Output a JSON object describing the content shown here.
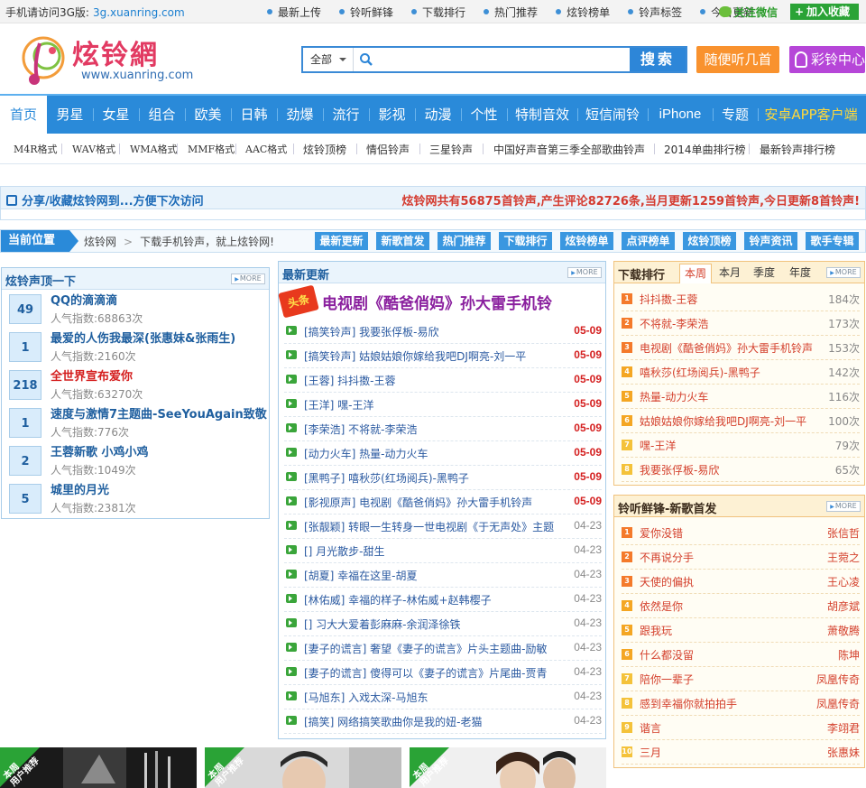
{
  "topbar": {
    "mobile_prefix": "手机请访问3G版:",
    "mobile_url": "3g.xuanring.com",
    "links": [
      "最新上传",
      "铃听鲜锋",
      "下载排行",
      "热门推荐",
      "炫铃榜单",
      "铃声标签",
      "今日更新"
    ],
    "wechat": "关注微信",
    "favorite": "加入收藏"
  },
  "logo": {
    "name": "炫铃網",
    "url": "www.xuanring.com"
  },
  "search": {
    "category": "全部",
    "placeholder": "",
    "button": "搜索"
  },
  "header_buttons": {
    "random": "随便听几首",
    "ring_center": "彩铃中心"
  },
  "main_nav": [
    "首页",
    "男星",
    "女星",
    "组合",
    "欧美",
    "日韩",
    "劲爆",
    "流行",
    "影视",
    "动漫",
    "个性",
    "特制音效",
    "短信闹铃",
    "iPhone",
    "专题",
    "安卓APP客户端"
  ],
  "sub_nav": [
    "M4R格式",
    "WAV格式",
    "WMA格式",
    "MMF格式",
    "AAC格式",
    "炫铃顶榜",
    "情侣铃声",
    "三星铃声",
    "中国好声音第三季全部歌曲铃声",
    "2014单曲排行榜",
    "最新铃声排行榜"
  ],
  "share_bar": {
    "left": "分享/收藏炫铃网到...方便下次访问",
    "stats": {
      "p1": "炫铃网共有",
      "rings": "56875",
      "p2": "首铃声,产生评论",
      "comments": "82726",
      "p3": "条,当月更新",
      "month": "1259",
      "p4": "首铃声,今日更新",
      "today": "8",
      "p5": "首铃声!"
    }
  },
  "location": {
    "label": "当前位置",
    "crumb_home": "炫铃网",
    "crumb_sep": ">",
    "crumb_text": "下载手机铃声，就上炫铃网!",
    "tags": [
      "最新更新",
      "新歌首发",
      "热门推荐",
      "下载排行",
      "炫铃榜单",
      "点评榜单",
      "炫铃顶榜",
      "铃声资讯",
      "歌手专辑"
    ]
  },
  "top_panel": {
    "title": "炫铃声顶一下",
    "more": "MORE",
    "items": [
      {
        "votes": "49",
        "title": "QQ的滴滴滴",
        "pop": "人气指数:68863次",
        "red": false
      },
      {
        "votes": "1",
        "title": "最爱的人伤我最深(张惠妹&张雨生)",
        "pop": "人气指数:2160次",
        "red": false
      },
      {
        "votes": "218",
        "title": "全世界宣布爱你",
        "pop": "人气指数:63270次",
        "red": true
      },
      {
        "votes": "1",
        "title": "速度与激情7主题曲-SeeYouAgain致敬",
        "pop": "人气指数:776次",
        "red": false
      },
      {
        "votes": "2",
        "title": "王蓉新歌 小鸡小鸡",
        "pop": "人气指数:1049次",
        "red": false
      },
      {
        "votes": "5",
        "title": "城里的月光",
        "pop": "人气指数:2381次",
        "red": false
      }
    ]
  },
  "latest_panel": {
    "title": "最新更新",
    "more": "MORE",
    "headline_badge": "头条",
    "headline": "电视剧《酷爸俏妈》孙大雷手机铃",
    "items": [
      {
        "text": "[搞笑铃声] 我要张俘板-易欣",
        "date": "05-09",
        "new": true
      },
      {
        "text": "[搞笑铃声] 姑娘姑娘你嫁给我吧DJ啊亮-刘一平",
        "date": "05-09",
        "new": true
      },
      {
        "text": "[王蓉] 抖抖擞-王蓉",
        "date": "05-09",
        "new": true
      },
      {
        "text": "[王洋] 嘿-王洋",
        "date": "05-09",
        "new": true
      },
      {
        "text": "[李荣浩] 不将就-李荣浩",
        "date": "05-09",
        "new": true
      },
      {
        "text": "[动力火车] 热量-动力火车",
        "date": "05-09",
        "new": true
      },
      {
        "text": "[黑鸭子] 嘻秋莎(红场阅兵)-黑鸭子",
        "date": "05-09",
        "new": true
      },
      {
        "text": "[影视原声] 电视剧《酷爸俏妈》孙大雷手机铃声",
        "date": "05-09",
        "new": true
      },
      {
        "text": "[张靓颖] 转眼一生转身一世电视剧《于无声处》主题",
        "date": "04-23",
        "new": false
      },
      {
        "text": "[] 月光散步-甜生",
        "date": "04-23",
        "new": false
      },
      {
        "text": "[胡夏] 幸福在这里-胡夏",
        "date": "04-23",
        "new": false
      },
      {
        "text": "[林佑威] 幸福的样子-林佑威+赵韩樱子",
        "date": "04-23",
        "new": false
      },
      {
        "text": "[] 习大大爱着彭麻麻-余润泽徐铁",
        "date": "04-23",
        "new": false
      },
      {
        "text": "[妻子的谎言] 奢望《妻子的谎言》片头主题曲-励敏",
        "date": "04-23",
        "new": false
      },
      {
        "text": "[妻子的谎言] 傻得可以《妻子的谎言》片尾曲-贾青",
        "date": "04-23",
        "new": false
      },
      {
        "text": "[马旭东] 入戏太深-马旭东",
        "date": "04-23",
        "new": false
      },
      {
        "text": "[搞笑] 网络搞笑歌曲你是我的妞-老猫",
        "date": "04-23",
        "new": false
      }
    ]
  },
  "download_rank": {
    "title": "下载排行",
    "tabs": [
      "本周",
      "本月",
      "季度",
      "年度"
    ],
    "more": "MORE",
    "items": [
      {
        "rank": "1",
        "title": "抖抖擞-王蓉",
        "count": "184次"
      },
      {
        "rank": "2",
        "title": "不将就-李荣浩",
        "count": "173次"
      },
      {
        "rank": "3",
        "title": "电视剧《酷爸俏妈》孙大雷手机铃声",
        "count": "153次"
      },
      {
        "rank": "4",
        "title": "嘻秋莎(红场阅兵)-黑鸭子",
        "count": "142次"
      },
      {
        "rank": "5",
        "title": "热量-动力火车",
        "count": "116次"
      },
      {
        "rank": "6",
        "title": "姑娘姑娘你嫁给我吧DJ啊亮-刘一平",
        "count": "100次"
      },
      {
        "rank": "7",
        "title": "嘿-王洋",
        "count": "79次"
      },
      {
        "rank": "8",
        "title": "我要张俘板-易欣",
        "count": "65次"
      }
    ]
  },
  "new_songs": {
    "title": "铃听鲜锋-新歌首发",
    "more": "MORE",
    "items": [
      {
        "rank": "1",
        "title": "爱你没错",
        "artist": "张信哲"
      },
      {
        "rank": "2",
        "title": "不再说分手",
        "artist": "王菀之"
      },
      {
        "rank": "3",
        "title": "天使的偏执",
        "artist": "王心凌"
      },
      {
        "rank": "4",
        "title": "依然是你",
        "artist": "胡彦斌"
      },
      {
        "rank": "5",
        "title": "跟我玩",
        "artist": "萧敬腾"
      },
      {
        "rank": "6",
        "title": "什么都没留",
        "artist": "陈坤"
      },
      {
        "rank": "7",
        "title": "陪你一辈子",
        "artist": "凤凰传奇"
      },
      {
        "rank": "8",
        "title": "感到幸福你就拍拍手",
        "artist": "凤凰传奇"
      },
      {
        "rank": "9",
        "title": "谐言",
        "artist": "李翊君"
      },
      {
        "rank": "10",
        "title": "三月",
        "artist": "张惠妹"
      }
    ]
  },
  "promos": [
    {
      "label_line1": "本周",
      "label_line2": "用户推荐"
    },
    {
      "label_line1": "本周",
      "label_line2": "用户推荐"
    },
    {
      "label_line1": "本周",
      "label_line2": "用户推荐"
    }
  ],
  "colors": {
    "brand_blue": "#2a8ad9",
    "accent_red": "#d41d1d",
    "orange_button": "#f9922e",
    "purple_button": "#b646d8",
    "wechat_green": "#2aa336"
  }
}
